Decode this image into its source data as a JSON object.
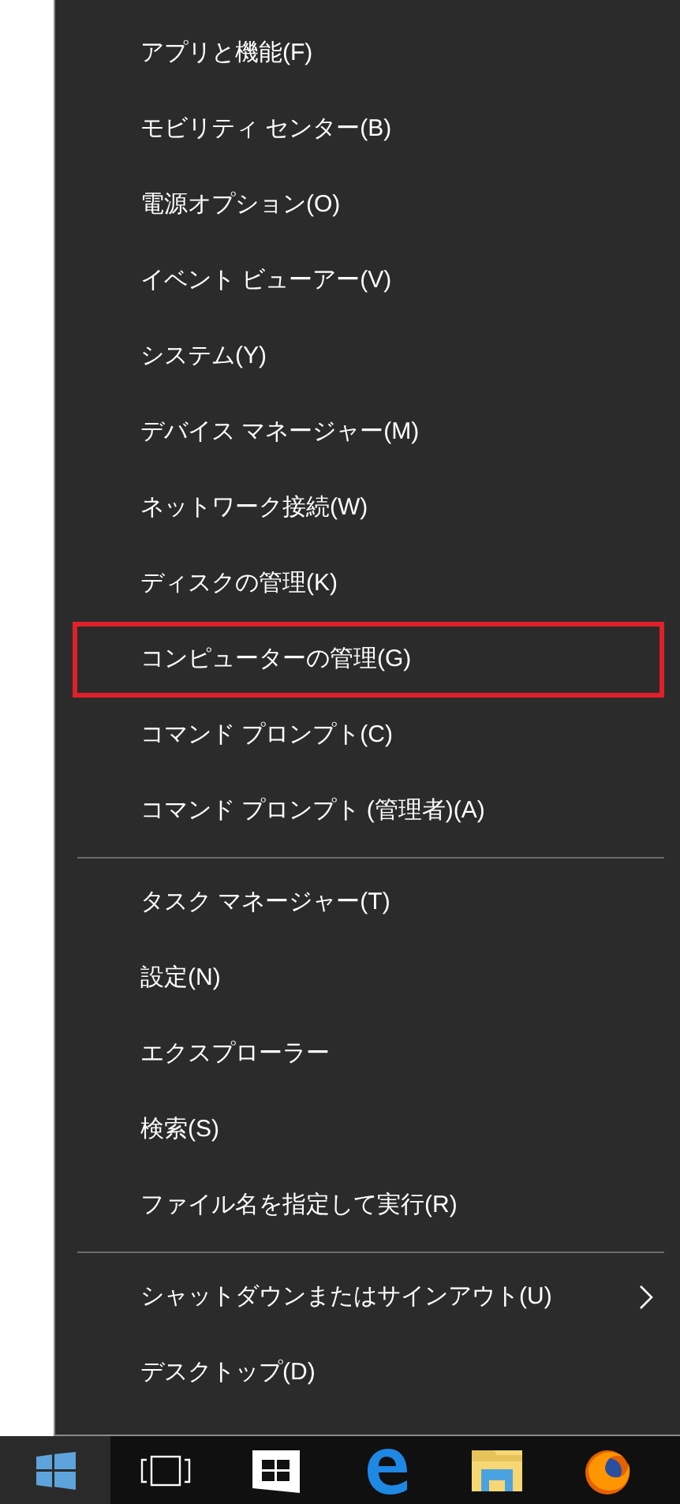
{
  "menu": {
    "groups": [
      {
        "items": [
          {
            "label": "アプリと機能(F)",
            "highlighted": false
          },
          {
            "label": "モビリティ センター(B)",
            "highlighted": false
          },
          {
            "label": "電源オプション(O)",
            "highlighted": false
          },
          {
            "label": "イベント ビューアー(V)",
            "highlighted": false
          },
          {
            "label": "システム(Y)",
            "highlighted": false
          },
          {
            "label": "デバイス マネージャー(M)",
            "highlighted": false
          },
          {
            "label": "ネットワーク接続(W)",
            "highlighted": false
          },
          {
            "label": "ディスクの管理(K)",
            "highlighted": false
          },
          {
            "label": "コンピューターの管理(G)",
            "highlighted": true
          },
          {
            "label": "コマンド プロンプト(C)",
            "highlighted": false
          },
          {
            "label": "コマンド プロンプト (管理者)(A)",
            "highlighted": false
          }
        ]
      },
      {
        "items": [
          {
            "label": "タスク マネージャー(T)",
            "highlighted": false
          },
          {
            "label": "設定(N)",
            "highlighted": false
          },
          {
            "label": "エクスプローラー",
            "highlighted": false
          },
          {
            "label": "検索(S)",
            "highlighted": false
          },
          {
            "label": "ファイル名を指定して実行(R)",
            "highlighted": false
          }
        ]
      },
      {
        "items": [
          {
            "label": "シャットダウンまたはサインアウト(U)",
            "highlighted": false,
            "submenu": true
          },
          {
            "label": "デスクトップ(D)",
            "highlighted": false
          }
        ]
      }
    ]
  },
  "taskbar": {
    "buttons": [
      {
        "kind": "start"
      },
      {
        "kind": "task-view"
      },
      {
        "kind": "store"
      },
      {
        "kind": "edge"
      },
      {
        "kind": "explorer"
      },
      {
        "kind": "firefox"
      }
    ]
  }
}
